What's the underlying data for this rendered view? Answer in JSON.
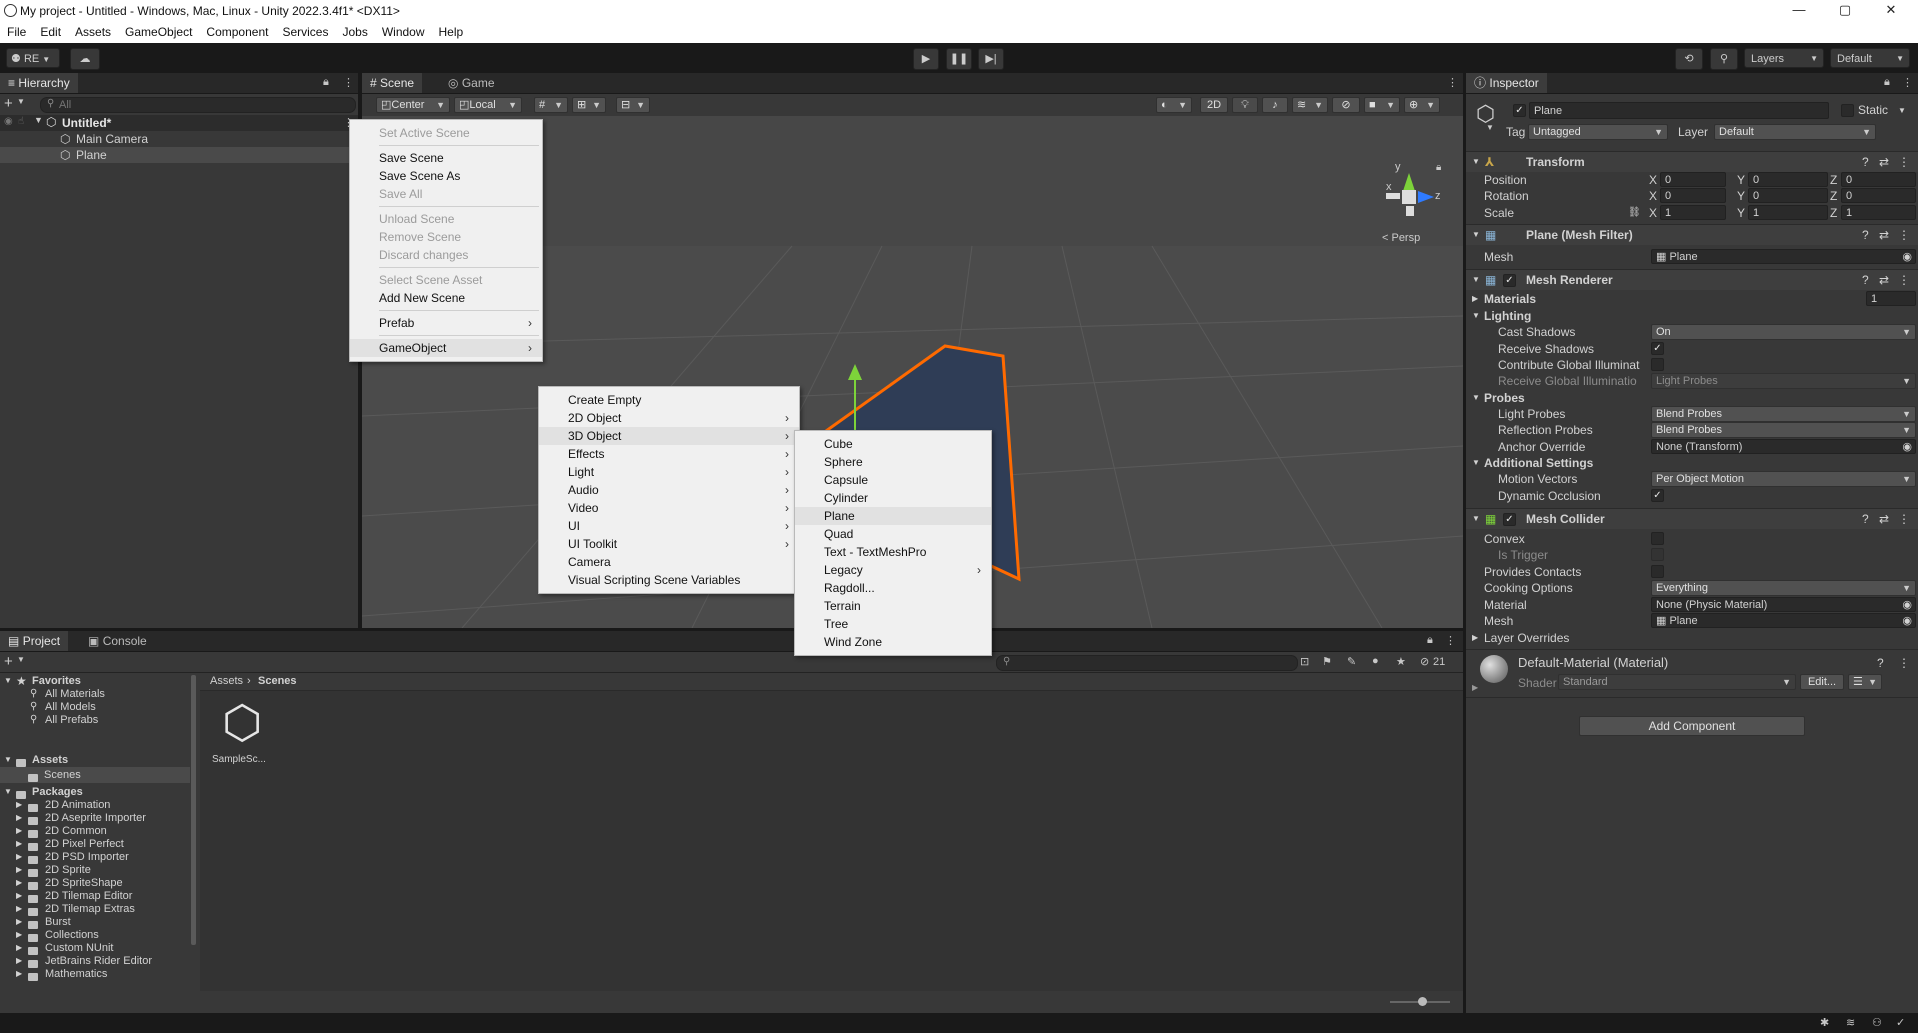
{
  "window": {
    "title": "My project - Untitled - Windows, Mac, Linux - Unity 2022.3.4f1* <DX11>",
    "controls": {
      "minimize": "—",
      "maximize": "▢",
      "close": "✕"
    }
  },
  "menubar": [
    "File",
    "Edit",
    "Assets",
    "GameObject",
    "Component",
    "Services",
    "Jobs",
    "Window",
    "Help"
  ],
  "toolbar": {
    "account_label": "RE",
    "layers_label": "Layers",
    "layout_label": "Default"
  },
  "hierarchy": {
    "tab_label": "Hierarchy",
    "search_placeholder": "All",
    "scene_name": "Untitled*",
    "items": [
      "Main Camera",
      "Plane"
    ]
  },
  "scene_view": {
    "tabs": [
      "Scene",
      "Game"
    ],
    "pivot_label": "Center",
    "space_label": "Local",
    "mode_2d_label": "2D",
    "persp_label": "< Persp",
    "gizmo_axes": {
      "y": "y",
      "x": "x",
      "z": "z"
    }
  },
  "context_menu": {
    "items": [
      {
        "label": "Set Active Scene",
        "disabled": true
      },
      {
        "sep": true
      },
      {
        "label": "Save Scene",
        "disabled": false
      },
      {
        "label": "Save Scene As",
        "disabled": false
      },
      {
        "label": "Save All",
        "disabled": true
      },
      {
        "sep": true
      },
      {
        "label": "Unload Scene",
        "disabled": true
      },
      {
        "label": "Remove Scene",
        "disabled": true
      },
      {
        "label": "Discard changes",
        "disabled": true
      },
      {
        "sep": true
      },
      {
        "label": "Select Scene Asset",
        "disabled": true
      },
      {
        "label": "Add New Scene",
        "disabled": false
      },
      {
        "sep": true
      },
      {
        "label": "Prefab",
        "disabled": false,
        "submenu": true
      },
      {
        "sep": true
      },
      {
        "label": "GameObject",
        "disabled": false,
        "submenu": true,
        "highlight": true
      }
    ]
  },
  "gameobject_menu": {
    "items": [
      {
        "label": "Create Empty"
      },
      {
        "label": "2D Object",
        "submenu": true
      },
      {
        "label": "3D Object",
        "submenu": true,
        "highlight": true
      },
      {
        "label": "Effects",
        "submenu": true
      },
      {
        "label": "Light",
        "submenu": true
      },
      {
        "label": "Audio",
        "submenu": true
      },
      {
        "label": "Video",
        "submenu": true
      },
      {
        "label": "UI",
        "submenu": true
      },
      {
        "label": "UI Toolkit",
        "submenu": true
      },
      {
        "label": "Camera"
      },
      {
        "label": "Visual Scripting Scene Variables"
      }
    ]
  },
  "object3d_menu": {
    "items": [
      {
        "label": "Cube"
      },
      {
        "label": "Sphere"
      },
      {
        "label": "Capsule"
      },
      {
        "label": "Cylinder"
      },
      {
        "label": "Plane",
        "highlight": true
      },
      {
        "label": "Quad"
      },
      {
        "label": "Text - TextMeshPro"
      },
      {
        "label": "Legacy",
        "submenu": true
      },
      {
        "label": "Ragdoll..."
      },
      {
        "label": "Terrain"
      },
      {
        "label": "Tree"
      },
      {
        "label": "Wind Zone"
      }
    ]
  },
  "project": {
    "tabs": [
      "Project",
      "Console"
    ],
    "favorites_label": "Favorites",
    "favorites": [
      "All Materials",
      "All Models",
      "All Prefabs"
    ],
    "assets_label": "Assets",
    "scenes_label": "Scenes",
    "packages_label": "Packages",
    "packages": [
      "2D Animation",
      "2D Aseprite Importer",
      "2D Common",
      "2D Pixel Perfect",
      "2D PSD Importer",
      "2D Sprite",
      "2D SpriteShape",
      "2D Tilemap Editor",
      "2D Tilemap Extras",
      "Burst",
      "Collections",
      "Custom NUnit",
      "JetBrains Rider Editor",
      "Mathematics"
    ],
    "breadcrumb": [
      "Assets",
      "Scenes"
    ],
    "asset_tile_label": "SampleSc...",
    "hidden_count": "21"
  },
  "inspector": {
    "tab_label": "Inspector",
    "object_name": "Plane",
    "static_label": "Static",
    "tag_label": "Tag",
    "tag_value": "Untagged",
    "layer_label": "Layer",
    "layer_value": "Default",
    "transform": {
      "title": "Transform",
      "rows": [
        {
          "label": "Position",
          "x": "0",
          "y": "0",
          "z": "0"
        },
        {
          "label": "Rotation",
          "x": "0",
          "y": "0",
          "z": "0"
        },
        {
          "label": "Scale",
          "x": "1",
          "y": "1",
          "z": "1"
        }
      ],
      "axis_x": "X",
      "axis_y": "Y",
      "axis_z": "Z"
    },
    "mesh_filter": {
      "title": "Plane (Mesh Filter)",
      "mesh_label": "Mesh",
      "mesh_value": "Plane"
    },
    "mesh_renderer": {
      "title": "Mesh Renderer",
      "materials_label": "Materials",
      "materials_count": "1",
      "lighting_label": "Lighting",
      "cast_shadows_label": "Cast Shadows",
      "cast_shadows_value": "On",
      "receive_shadows_label": "Receive Shadows",
      "contribute_gi_label": "Contribute Global Illuminat",
      "receive_gi_label": "Receive Global Illuminatio",
      "receive_gi_value": "Light Probes",
      "probes_label": "Probes",
      "light_probes_label": "Light Probes",
      "light_probes_value": "Blend Probes",
      "reflection_probes_label": "Reflection Probes",
      "reflection_probes_value": "Blend Probes",
      "anchor_override_label": "Anchor Override",
      "anchor_override_value": "None (Transform)",
      "additional_label": "Additional Settings",
      "motion_vectors_label": "Motion Vectors",
      "motion_vectors_value": "Per Object Motion",
      "dynamic_occlusion_label": "Dynamic Occlusion"
    },
    "mesh_collider": {
      "title": "Mesh Collider",
      "convex_label": "Convex",
      "is_trigger_label": "Is Trigger",
      "provides_contacts_label": "Provides Contacts",
      "cooking_label": "Cooking Options",
      "cooking_value": "Everything",
      "material_label": "Material",
      "material_value": "None (Physic Material)",
      "mesh_label": "Mesh",
      "mesh_value": "Plane",
      "layer_overrides_label": "Layer Overrides"
    },
    "material": {
      "title": "Default-Material (Material)",
      "shader_label": "Shader",
      "shader_value": "Standard",
      "edit_label": "Edit..."
    },
    "add_component_label": "Add Component"
  }
}
